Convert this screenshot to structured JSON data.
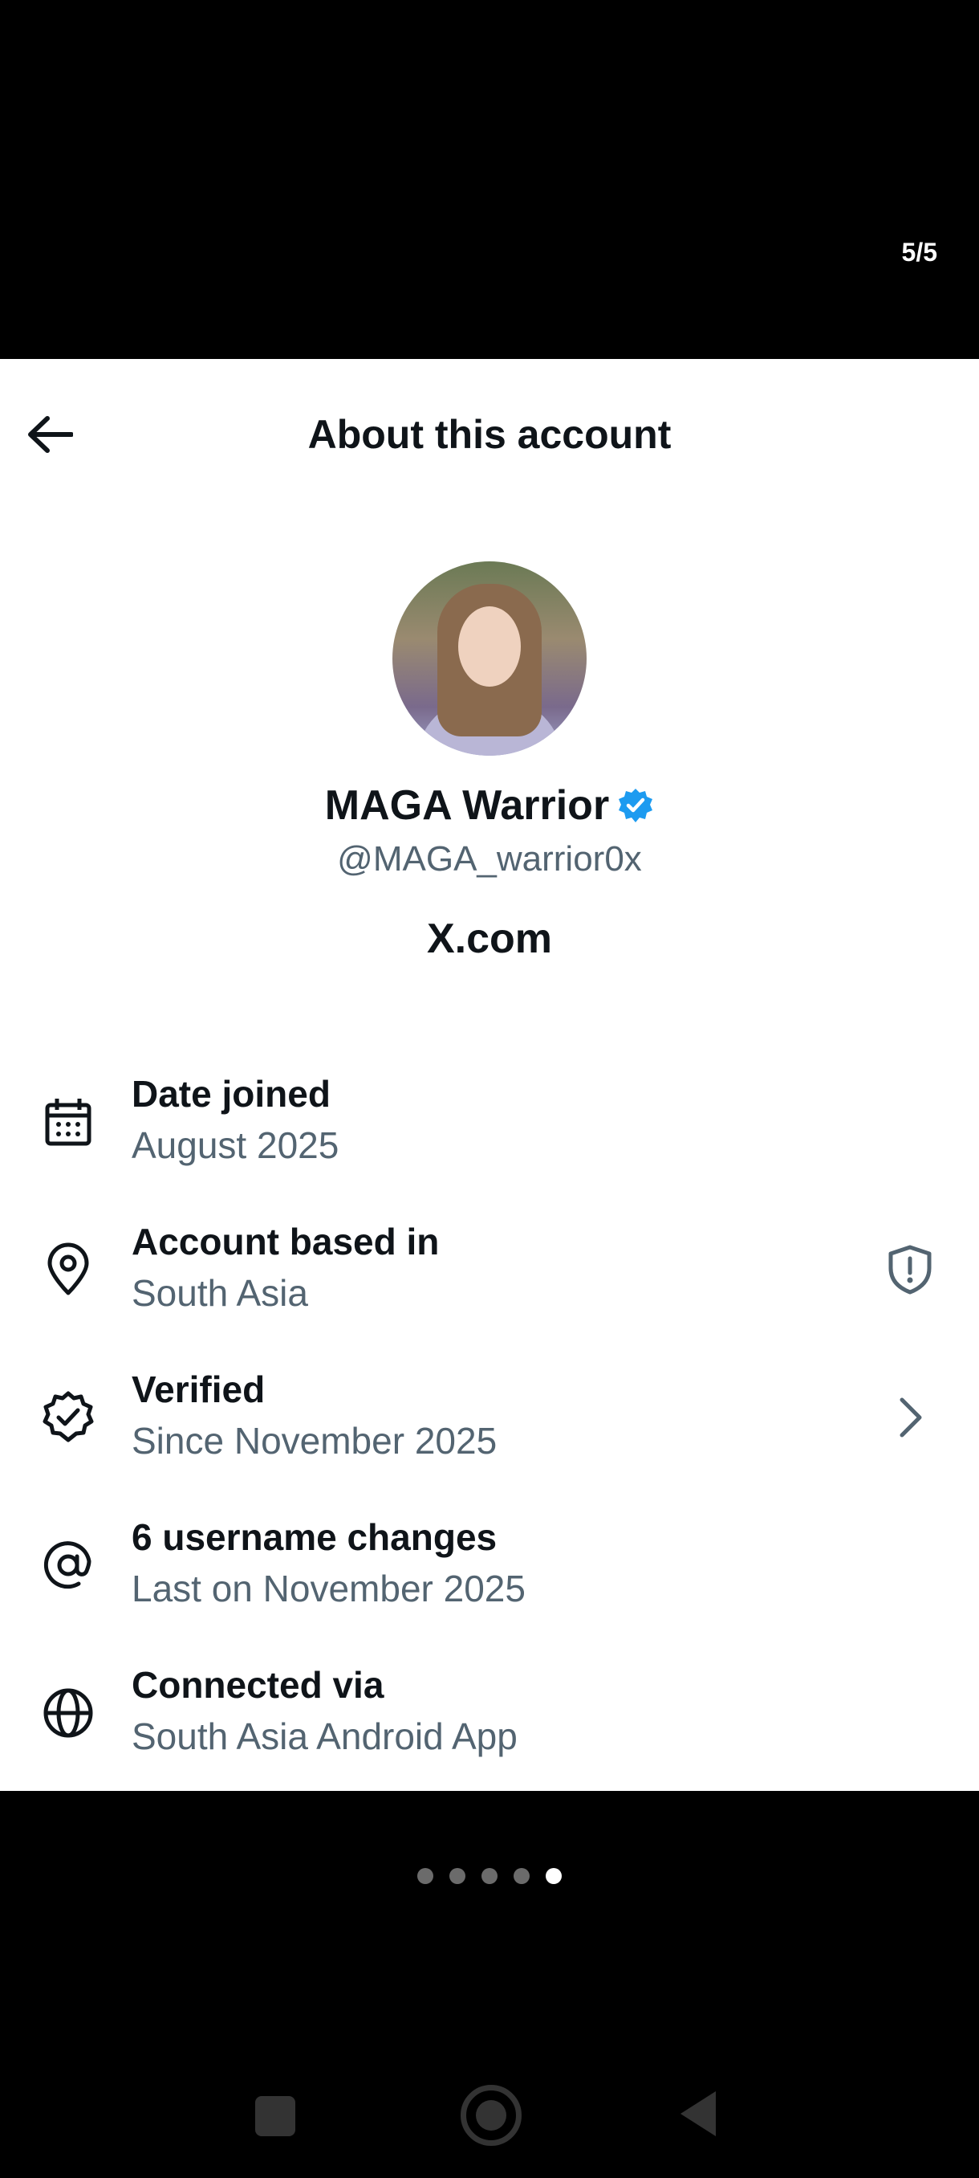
{
  "viewer": {
    "counter": "5/5"
  },
  "header": {
    "title": "About this account",
    "back_icon": "arrow-left-icon"
  },
  "profile": {
    "name": "MAGA Warrior",
    "handle": "@MAGA_warrior0x",
    "site": "X.com",
    "verified_badge_color": "#1d9bf0"
  },
  "info_rows": [
    {
      "icon": "calendar-icon",
      "label": "Date joined",
      "value": "August 2025"
    },
    {
      "icon": "location-pin-icon",
      "label": "Account based in",
      "value": "South Asia",
      "trailing_icon": "shield-alert-icon"
    },
    {
      "icon": "verified-badge-icon",
      "label": "Verified",
      "value": "Since November 2025",
      "trailing_icon": "chevron-right-icon"
    },
    {
      "icon": "at-sign-icon",
      "label": "6 username changes",
      "value": "Last on November 2025"
    },
    {
      "icon": "globe-icon",
      "label": "Connected via",
      "value": "South Asia Android App"
    }
  ],
  "pager": {
    "total": 5,
    "active_index": 4
  },
  "colors": {
    "text_primary": "#0f1419",
    "text_secondary": "#536471",
    "backdrop": "#000000"
  }
}
